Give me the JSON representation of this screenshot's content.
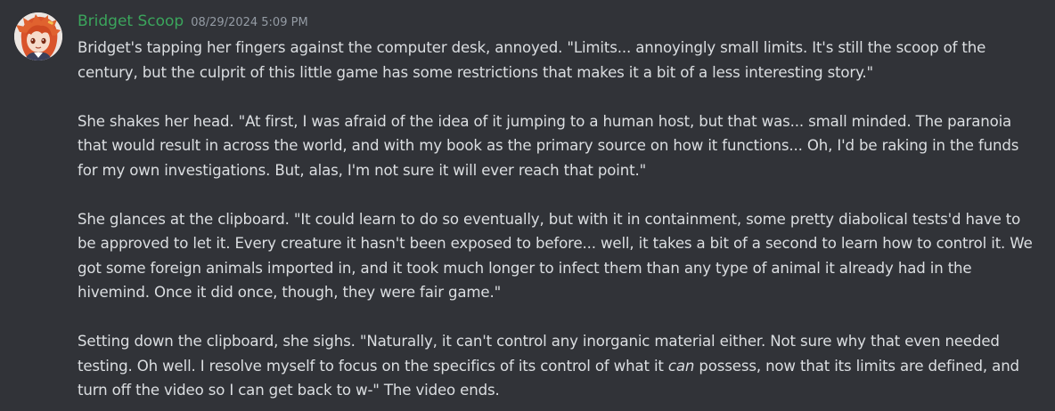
{
  "message": {
    "author": "Bridget Scoop",
    "timestamp": "08/29/2024 5:09 PM",
    "author_color": "#3ba55c",
    "avatar_icon": "anime-girl-avatar",
    "paragraphs": [
      "Bridget's tapping her fingers against the computer desk, annoyed. \"Limits... annoyingly small limits. It's still the scoop of the century, but the culprit of this little game has some restrictions that makes it a bit of a less interesting story.\"",
      "She shakes her head. \"At first, I was afraid of the idea of it jumping to a human host, but that was... small minded. The paranoia that would result in across the world, and with my book as the primary source on how it functions... Oh, I'd be raking in the funds for my own investigations. But, alas, I'm not sure it will ever reach that point.\"",
      "She glances at the clipboard. \"It could learn to do so eventually, but with it in containment, some pretty diabolical tests'd have to be approved to let it. Every creature it hasn't been exposed to before... well, it takes a bit of a second to learn how to control it. We got some foreign animals imported in, and it took much longer to infect them than any type of animal it already had in the hivemind. Once it did once, though, they were fair game.\""
    ],
    "last_paragraph": {
      "before_italic": "Setting down the clipboard, she sighs. \"Naturally, it can't control any inorganic material either. Not sure why that even needed testing. Oh well. I resolve myself to focus on the specifics of its control of what it ",
      "italic": "can",
      "after_italic": " possess, now that its limits are defined, and turn off the video so I can get back to w-\" The video ends."
    }
  }
}
